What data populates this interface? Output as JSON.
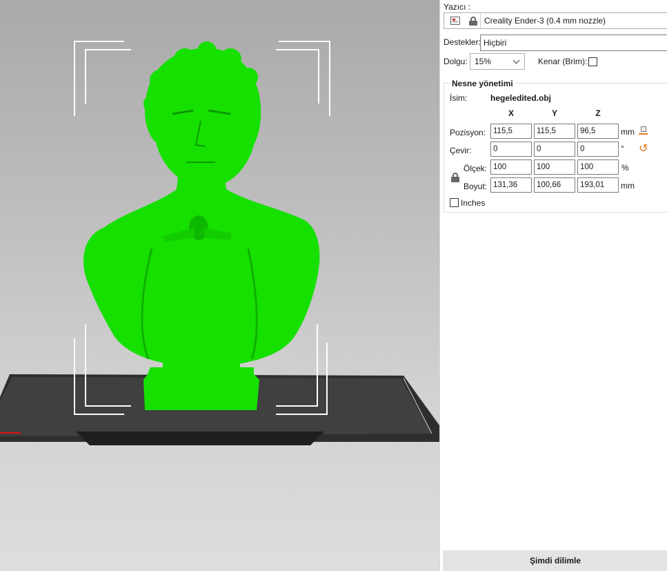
{
  "printer": {
    "label": "Yazıcı :",
    "name": "Creality Ender-3 (0.4 mm nozzle)"
  },
  "supports": {
    "label": "Destekler:",
    "value": "Hiçbiri"
  },
  "infill": {
    "label": "Dolgu:",
    "value": "15%"
  },
  "brim": {
    "label": "Kenar (Brim):",
    "checked": false
  },
  "object_manager": {
    "title": "Nesne yönetimi",
    "name_label": "İsim:",
    "name_value": "hegeledited.obj",
    "axes": [
      "X",
      "Y",
      "Z"
    ],
    "position": {
      "label": "Pozisyon:",
      "values": [
        "115,5",
        "115,5",
        "96,5"
      ],
      "unit": "mm"
    },
    "rotation": {
      "label": "Çevir:",
      "values": [
        "0",
        "0",
        "0"
      ],
      "unit": "°"
    },
    "scale": {
      "label": "Ölçek:",
      "values": [
        "100",
        "100",
        "100"
      ],
      "unit": "%"
    },
    "size": {
      "label": "Boyut:",
      "values": [
        "131,36",
        "100,66",
        "193,01"
      ],
      "unit": "mm"
    },
    "inches": {
      "label": "Inches",
      "checked": false
    }
  },
  "slice_button": "Şimdi dilimle",
  "colors": {
    "model": "#16e000",
    "bed": "#3a3a3a",
    "reset_icon": "#e07a1f",
    "panel_bg": "#ffffff",
    "button_bg": "#e4e4e4"
  },
  "icons": {
    "printer": "printer-settings-icon",
    "lock": "lock-icon",
    "drop_to_bed": "drop-to-bed-icon",
    "reset_rotation": "reset-rotation-icon",
    "scale_lock": "scale-lock-icon",
    "dropdown": "chevron-down-icon"
  }
}
